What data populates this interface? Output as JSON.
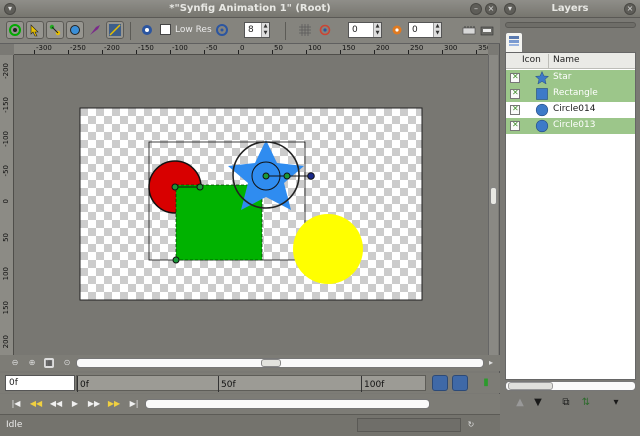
{
  "window": {
    "title": "*\"Synfig Animation 1\" (Root)"
  },
  "toolbar": {
    "low_res_label": "Low Res",
    "low_res_checked": false,
    "quality_value": "8",
    "onion_past_value": "0",
    "onion_future_value": "0"
  },
  "ruler": {
    "h_labels": [
      "-300",
      "-250",
      "-200",
      "-150",
      "-100",
      "-50",
      "0",
      "50",
      "100",
      "150",
      "200",
      "250",
      "300",
      "350"
    ],
    "v_labels": [
      "-200",
      "-150",
      "-100",
      "-50",
      "0",
      "50",
      "100",
      "150",
      "200"
    ]
  },
  "canvas_layers": {
    "star_color": "#2f8cf0",
    "rectangle_color": "#00b200",
    "red_circle_color": "#d80000",
    "yellow_circle_color": "#ffff00"
  },
  "timebar": {
    "current_time": "0f",
    "labels": [
      "0f",
      "50f",
      "100f"
    ]
  },
  "status": {
    "text": "Idle"
  },
  "layers_panel": {
    "title": "Layers",
    "columns": {
      "icon": "Icon",
      "name": "Name"
    },
    "items": [
      {
        "name": "Star",
        "icon": "star-icon",
        "selected": true
      },
      {
        "name": "Rectangle",
        "icon": "rectangle-icon",
        "selected": true
      },
      {
        "name": "Circle014",
        "icon": "circle-icon",
        "selected": false
      },
      {
        "name": "Circle013",
        "icon": "circle-icon",
        "selected": true
      }
    ]
  }
}
